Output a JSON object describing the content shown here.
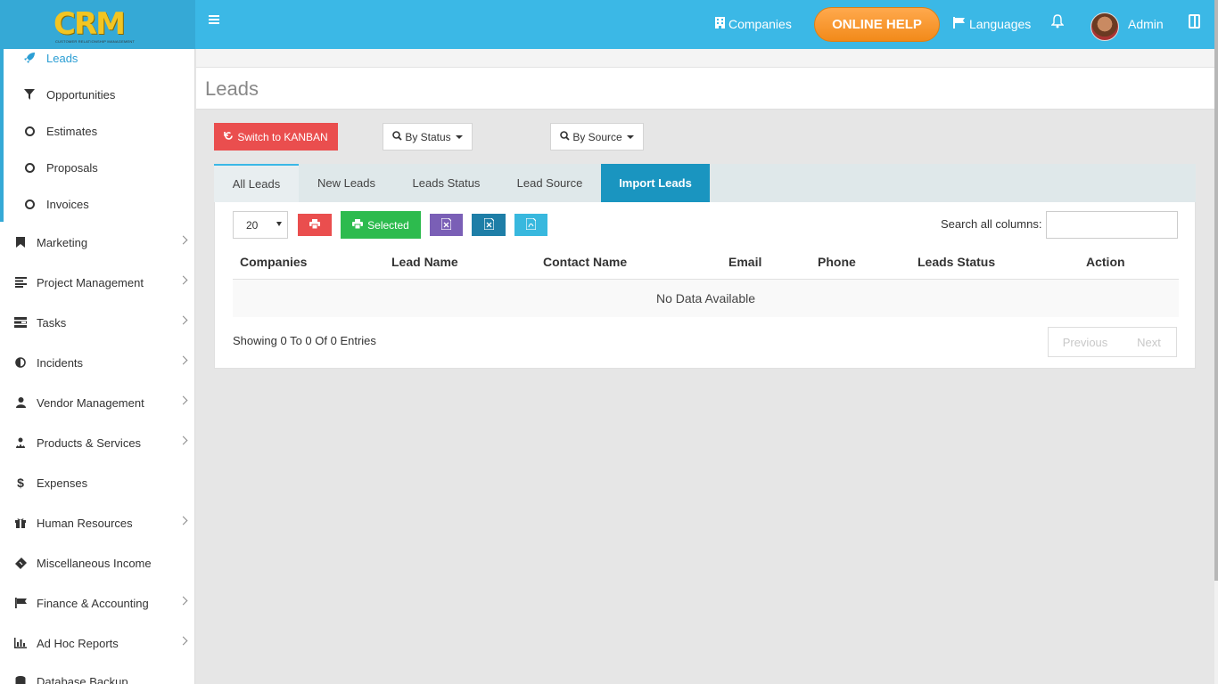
{
  "header": {
    "logo_text": "CRM",
    "logo_subtitle": "CUSTOMER RELATIONSHIP MANAGEMENT",
    "companies_label": "Companies",
    "online_help_label": "ONLINE HELP",
    "languages_label": "Languages",
    "user_name": "Admin"
  },
  "sidebar": {
    "sub_items": [
      {
        "label": "Leads",
        "icon": "rocket-icon",
        "active": true
      },
      {
        "label": "Opportunities",
        "icon": "filter-icon"
      },
      {
        "label": "Estimates",
        "icon": "circle-icon"
      },
      {
        "label": "Proposals",
        "icon": "circle-icon"
      },
      {
        "label": "Invoices",
        "icon": "circle-icon"
      }
    ],
    "items": [
      {
        "label": "Marketing",
        "icon": "bookmark-icon",
        "has_children": true
      },
      {
        "label": "Project Management",
        "icon": "align-left-icon",
        "has_children": true
      },
      {
        "label": "Tasks",
        "icon": "tasks-icon",
        "has_children": true
      },
      {
        "label": "Incidents",
        "icon": "adjust-icon",
        "has_children": true
      },
      {
        "label": "Vendor Management",
        "icon": "user-icon",
        "has_children": true
      },
      {
        "label": "Products & Services",
        "icon": "users-icon",
        "has_children": true
      },
      {
        "label": "Expenses",
        "icon": "dollar-icon",
        "has_children": false
      },
      {
        "label": "Human Resources",
        "icon": "gift-icon",
        "has_children": true
      },
      {
        "label": "Miscellaneous Income",
        "icon": "ticket-icon",
        "has_children": false
      },
      {
        "label": "Finance & Accounting",
        "icon": "flag-icon",
        "has_children": true
      },
      {
        "label": "Ad Hoc Reports",
        "icon": "bar-chart-icon",
        "has_children": true
      },
      {
        "label": "Database Backup",
        "icon": "database-icon",
        "has_children": false
      }
    ]
  },
  "page": {
    "title": "Leads"
  },
  "filters": {
    "kanban_label": "Switch to KANBAN",
    "by_status_label": "By Status",
    "by_source_label": "By Source"
  },
  "tabs": [
    "All Leads",
    "New Leads",
    "Leads Status",
    "Lead Source",
    "Import Leads"
  ],
  "active_tab": "Import Leads",
  "table": {
    "page_length": "20",
    "selected_label": "Selected",
    "search_label": "Search all columns:",
    "search_value": "",
    "columns": [
      "Companies",
      "Lead Name",
      "Contact Name",
      "Email",
      "Phone",
      "Leads Status",
      "Action"
    ],
    "empty_message": "No Data Available",
    "info": "Showing 0 To 0 Of 0 Entries",
    "prev_label": "Previous",
    "next_label": "Next"
  },
  "colors": {
    "header_bg": "#3bb8e6",
    "accent": "#1a95c0",
    "danger": "#ea4e4e",
    "success": "#2dbb4e",
    "purple": "#7a5fb6",
    "teal": "#1e7ea7",
    "cyan": "#38b8de",
    "help_orange": "#f28a1a"
  }
}
